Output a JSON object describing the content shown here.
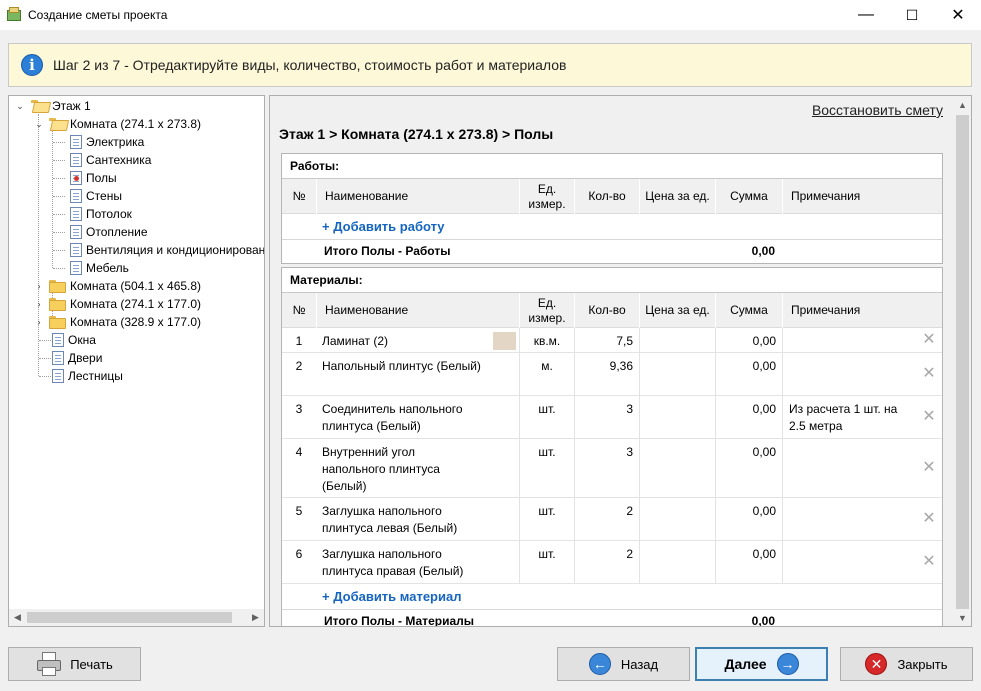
{
  "window": {
    "title": "Создание сметы проекта",
    "minimize": "—",
    "maximize": "☐",
    "close": "✕"
  },
  "banner": {
    "icon": "i",
    "text": "Шаг 2 из 7 - Отредактируйте виды, количество, стоимость работ и материалов"
  },
  "tree": {
    "items": [
      {
        "label": "Этаж 1",
        "icon": "folder-open-icon"
      },
      {
        "label": "Комната (274.1 x 273.8)",
        "icon": "folder-open-icon"
      },
      {
        "label": "Электрика",
        "icon": "document-icon"
      },
      {
        "label": "Сантехника",
        "icon": "document-icon"
      },
      {
        "label": "Полы",
        "icon": "document-active-icon"
      },
      {
        "label": "Стены",
        "icon": "document-icon"
      },
      {
        "label": "Потолок",
        "icon": "document-icon"
      },
      {
        "label": "Отопление",
        "icon": "document-icon"
      },
      {
        "label": "Вентиляция и кондиционирование",
        "icon": "document-icon"
      },
      {
        "label": "Мебель",
        "icon": "document-icon"
      },
      {
        "label": "Комната (504.1 x 465.8)",
        "icon": "folder-icon"
      },
      {
        "label": "Комната (274.1 x 177.0)",
        "icon": "folder-icon"
      },
      {
        "label": "Комната (328.9 x 177.0)",
        "icon": "folder-icon"
      },
      {
        "label": "Окна",
        "icon": "document-icon"
      },
      {
        "label": "Двери",
        "icon": "document-icon"
      },
      {
        "label": "Лестницы",
        "icon": "document-icon"
      }
    ],
    "scroll_left": "◀",
    "scroll_right": "▶"
  },
  "main": {
    "restore_link": "Восстановить смету",
    "breadcrumb": "Этаж 1 > Комната (274.1 x 273.8) > Полы",
    "scroll_up": "▲",
    "scroll_down": "▼",
    "columns": {
      "num": "№",
      "name": "Наименование",
      "unit": "Ед. измер.",
      "qty": "Кол-во",
      "price": "Цена за ед.",
      "sum": "Сумма",
      "notes": "Примечания"
    },
    "works": {
      "title": "Работы:",
      "add_label": "+ Добавить работу",
      "total_label": "Итого Полы - Работы",
      "total_value": "0,00"
    },
    "materials": {
      "title": "Материалы:",
      "add_label": "+ Добавить материал",
      "total_label": "Итого Полы - Материалы",
      "total_value": "0,00",
      "rows": [
        {
          "num": "1",
          "name": "Ламинат (2)",
          "unit": "кв.м.",
          "qty": "7,5",
          "price": "",
          "sum": "0,00",
          "notes": ""
        },
        {
          "num": "2",
          "name": "Напольный плинтус (Белый)",
          "unit": "м.",
          "qty": "9,36",
          "price": "",
          "sum": "0,00",
          "notes": ""
        },
        {
          "num": "3",
          "name": "Соединитель напольного плинтуса (Белый)",
          "unit": "шт.",
          "qty": "3",
          "price": "",
          "sum": "0,00",
          "notes": "Из расчета 1 шт. на 2.5 метра"
        },
        {
          "num": "4",
          "name": "Внутренний угол напольного плинтуса (Белый)",
          "unit": "шт.",
          "qty": "3",
          "price": "",
          "sum": "0,00",
          "notes": ""
        },
        {
          "num": "5",
          "name": "Заглушка напольного плинтуса левая (Белый)",
          "unit": "шт.",
          "qty": "2",
          "price": "",
          "sum": "0,00",
          "notes": ""
        },
        {
          "num": "6",
          "name": "Заглушка напольного плинтуса правая (Белый)",
          "unit": "шт.",
          "qty": "2",
          "price": "",
          "sum": "0,00",
          "notes": ""
        }
      ]
    }
  },
  "footer": {
    "print_label": "Печать",
    "back_label": "Назад",
    "next_label": "Далее",
    "close_label": "Закрыть",
    "back_icon": "←",
    "next_icon": "→",
    "close_icon": "✕"
  }
}
